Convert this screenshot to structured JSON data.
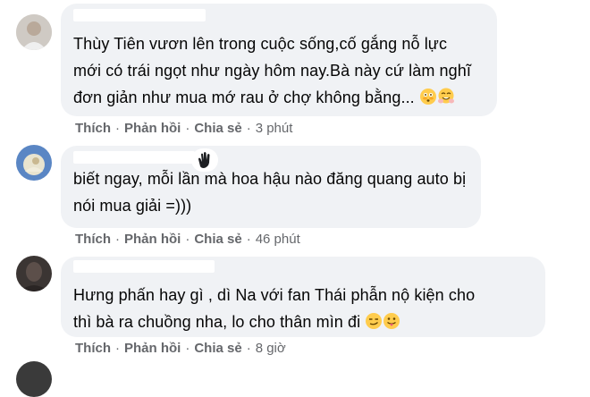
{
  "comments": [
    {
      "text": "Thùy Tiên vươn lên trong cuộc sống,cố gắng nỗ lực\nmới có trái ngọt như ngày hôm nay.Bà này cứ làm nghĩ\nđơn giản như mua mớ rau ở chợ không bằng...",
      "emojis": [
        "flushed-face-icon",
        "hugging-face-icon"
      ],
      "actions": {
        "like": "Thích",
        "reply": "Phản hồi",
        "share": "Chia sẻ"
      },
      "time": "3 phút"
    },
    {
      "text": "biết ngay, mỗi lần mà hoa hậu nào đăng quang auto bị\nnói mua giải =)))",
      "emojis": [],
      "actions": {
        "like": "Thích",
        "reply": "Phản hồi",
        "share": "Chia sẻ"
      },
      "time": "46 phút"
    },
    {
      "text": "Hưng phấn hay gì , dì Na với fan Thái phẫn nộ kiện cho\nthì bà ra chuồng nha, lo cho thân mìn đi",
      "emojis": [
        "smirking-face-icon",
        "tongue-out-face-icon"
      ],
      "actions": {
        "like": "Thích",
        "reply": "Phản hồi",
        "share": "Chia sẻ"
      },
      "time": "8 giờ"
    }
  ],
  "colors": {
    "bubble": "#f0f2f5",
    "text": "#050505",
    "meta": "#65676b"
  }
}
